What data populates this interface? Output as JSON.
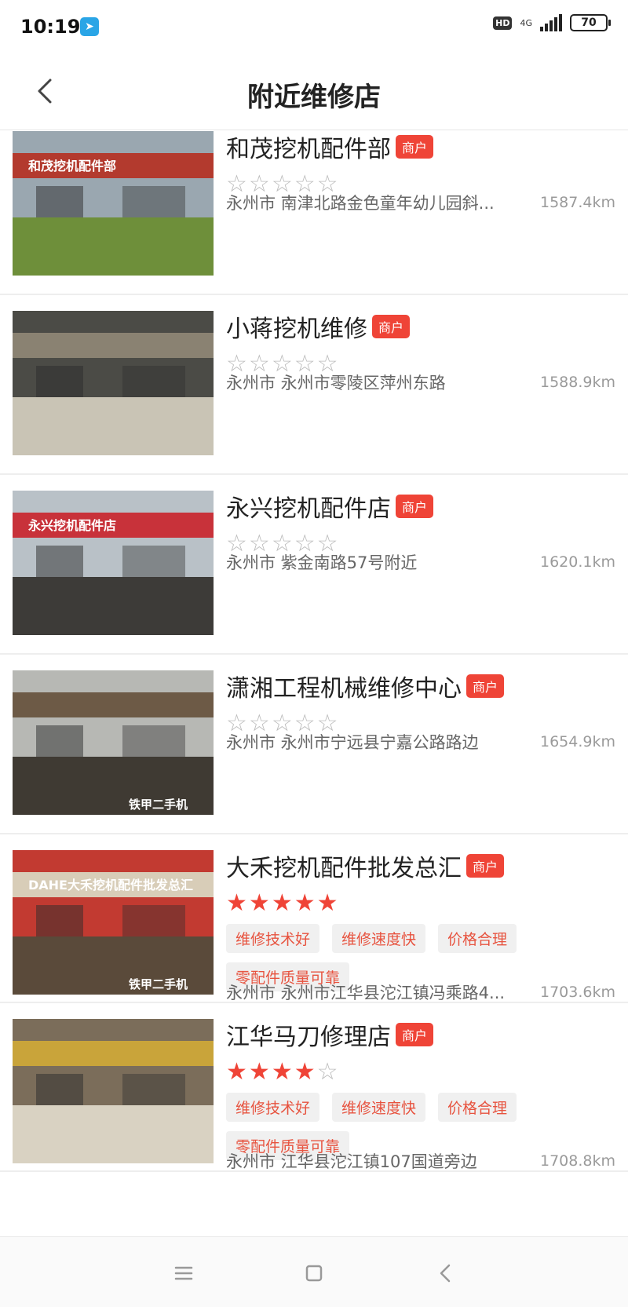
{
  "status_bar": {
    "time": "10:19",
    "hd": "HD",
    "network": "4G",
    "battery": "70"
  },
  "header": {
    "title": "附近维修店",
    "back_icon": "chevron-left-icon"
  },
  "shops": [
    {
      "name": "和茂挖机配件部",
      "badge": "商户",
      "stars": 0,
      "stars_text": "☆☆☆☆☆",
      "tags": [],
      "address": "永州市 南津北路金色童年幼儿园斜...",
      "distance": "1587.4km",
      "image": {
        "sign": "和茂挖机配件部"
      }
    },
    {
      "name": "小蒋挖机维修",
      "badge": "商户",
      "stars": 0,
      "stars_text": "☆☆☆☆☆",
      "tags": [],
      "address": "永州市 永州市零陵区萍州东路",
      "distance": "1588.9km",
      "image": {
        "sign": ""
      }
    },
    {
      "name": "永兴挖机配件店",
      "badge": "商户",
      "stars": 0,
      "stars_text": "☆☆☆☆☆",
      "tags": [],
      "address": "永州市 紫金南路57号附近",
      "distance": "1620.1km",
      "image": {
        "sign": "永兴挖机配件店"
      }
    },
    {
      "name": "潇湘工程机械维修中心",
      "badge": "商户",
      "stars": 0,
      "stars_text": "☆☆☆☆☆",
      "tags": [],
      "address": "永州市 永州市宁远县宁嘉公路路边",
      "distance": "1654.9km",
      "image": {
        "sign": "",
        "watermark": "铁甲二手机"
      }
    },
    {
      "name": "大禾挖机配件批发总汇",
      "badge": "商户",
      "stars": 5,
      "stars_text": "★★★★★",
      "tags": [
        "维修技术好",
        "维修速度快",
        "价格合理",
        "零配件质量可靠"
      ],
      "address": "永州市 永州市江华县沱江镇冯乘路4...",
      "distance": "1703.6km",
      "image": {
        "sign": "DAHE大禾挖机配件批发总汇",
        "watermark": "铁甲二手机"
      }
    },
    {
      "name": "江华马刀修理店",
      "badge": "商户",
      "stars": 4,
      "stars_text": "★★★★☆",
      "tags": [
        "维修技术好",
        "维修速度快",
        "价格合理",
        "零配件质量可靠"
      ],
      "address": "永州市 江华县沱江镇107国道旁边",
      "distance": "1708.8km",
      "image": {
        "sign": ""
      }
    }
  ],
  "nav_bar": {
    "menu_icon": "menu-icon",
    "home_icon": "home-square-icon",
    "back_icon": "back-triangle-icon"
  },
  "colors": {
    "accent": "#ef4437",
    "tag_text": "#e7533f",
    "tag_bg": "#f0f0f0"
  }
}
